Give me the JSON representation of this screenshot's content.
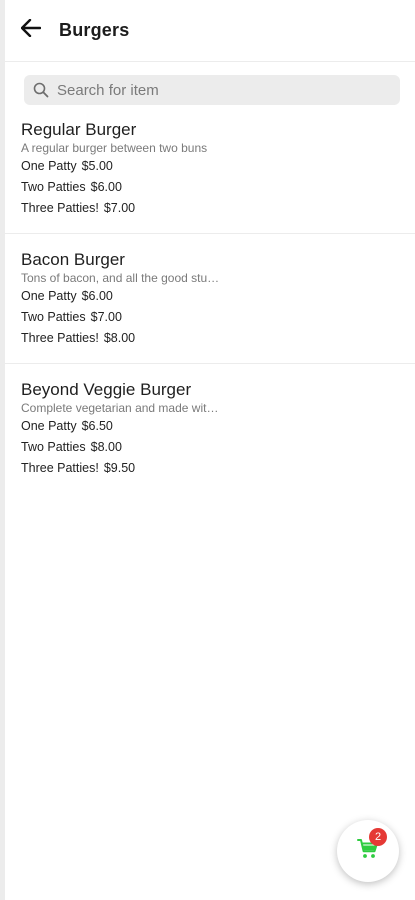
{
  "header": {
    "title": "Burgers",
    "back_icon": "arrow-left-icon"
  },
  "search": {
    "placeholder": "Search for item",
    "icon": "search-icon"
  },
  "items": [
    {
      "name": "Regular Burger",
      "description": "A regular burger between two buns",
      "options": [
        {
          "label": "One Patty",
          "price": "$5.00"
        },
        {
          "label": "Two Patties",
          "price": "$6.00"
        },
        {
          "label": "Three Patties!",
          "price": "$7.00"
        }
      ]
    },
    {
      "name": "Bacon Burger",
      "description": "Tons of bacon, and all the good stu…",
      "options": [
        {
          "label": "One Patty",
          "price": "$6.00"
        },
        {
          "label": "Two Patties",
          "price": "$7.00"
        },
        {
          "label": "Three Patties!",
          "price": "$8.00"
        }
      ]
    },
    {
      "name": "Beyond Veggie Burger",
      "description": "Complete vegetarian and made wit…",
      "options": [
        {
          "label": "One Patty",
          "price": "$6.50"
        },
        {
          "label": "Two Patties",
          "price": "$8.00"
        },
        {
          "label": "Three Patties!",
          "price": "$9.50"
        }
      ]
    }
  ],
  "cart": {
    "count": "2",
    "icon": "cart-icon",
    "icon_color": "#2ecc40",
    "badge_color": "#e53935"
  }
}
